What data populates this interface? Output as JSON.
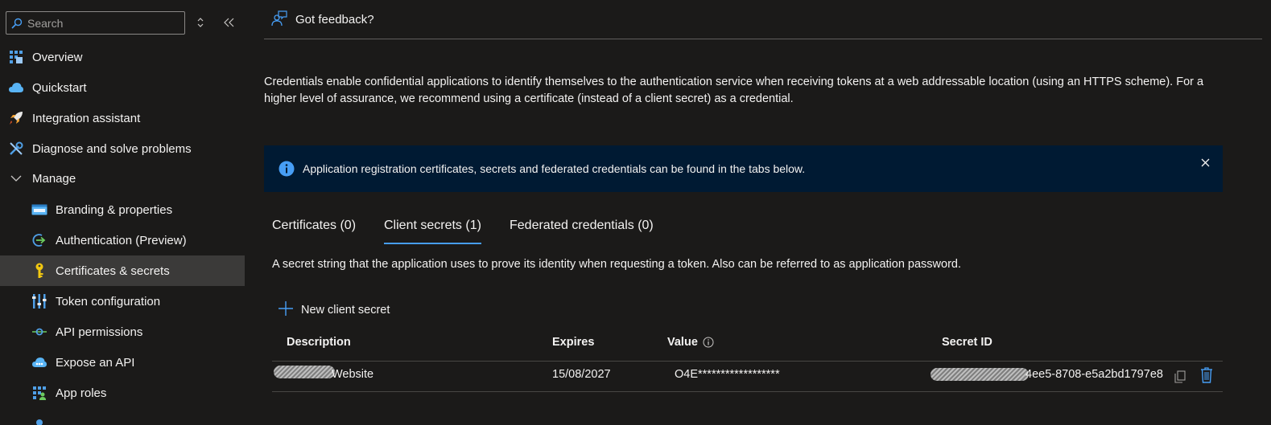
{
  "search": {
    "placeholder": "Search"
  },
  "sidebar": {
    "items": [
      {
        "label": "Overview",
        "icon": "overview-grid-icon"
      },
      {
        "label": "Quickstart",
        "icon": "cloud-rocket-icon"
      },
      {
        "label": "Integration assistant",
        "icon": "rocket-icon"
      },
      {
        "label": "Diagnose and solve problems",
        "icon": "wrench-icon"
      },
      {
        "label": "Manage",
        "icon": "chevron-down-icon"
      },
      {
        "label": "Branding & properties",
        "icon": "www-icon"
      },
      {
        "label": "Authentication (Preview)",
        "icon": "auth-arrow-icon"
      },
      {
        "label": "Certificates & secrets",
        "icon": "key-icon"
      },
      {
        "label": "Token configuration",
        "icon": "token-bars-icon"
      },
      {
        "label": "API permissions",
        "icon": "api-permissions-icon"
      },
      {
        "label": "Expose an API",
        "icon": "cloud-api-icon"
      },
      {
        "label": "App roles",
        "icon": "app-roles-icon"
      }
    ]
  },
  "header": {
    "feedback_label": "Got feedback?"
  },
  "intro_text": "Credentials enable confidential applications to identify themselves to the authentication service when receiving tokens at a web addressable location (using an HTTPS scheme). For a higher level of assurance, we recommend using a certificate (instead of a client secret) as a credential.",
  "info_banner": {
    "text": "Application registration certificates, secrets and federated credentials can be found in the tabs below."
  },
  "tabs": [
    {
      "label": "Certificates (0)"
    },
    {
      "label": "Client secrets (1)"
    },
    {
      "label": "Federated credentials (0)"
    }
  ],
  "tab_description": "A secret string that the application uses to prove its identity when requesting a token. Also can be referred to as application password.",
  "toolbar": {
    "new_secret_label": "New client secret"
  },
  "table": {
    "columns": [
      "Description",
      "Expires",
      "Value",
      "Secret ID"
    ],
    "rows": [
      {
        "description": "Website",
        "expires": "15/08/2027",
        "value": "O4E******************",
        "secret_id": "4ee5-8708-e5a2bd1797e8"
      }
    ]
  },
  "colors": {
    "accent": "#479ef5",
    "banner_bg": "#001a33",
    "active_nav_bg": "#3b3a39"
  }
}
